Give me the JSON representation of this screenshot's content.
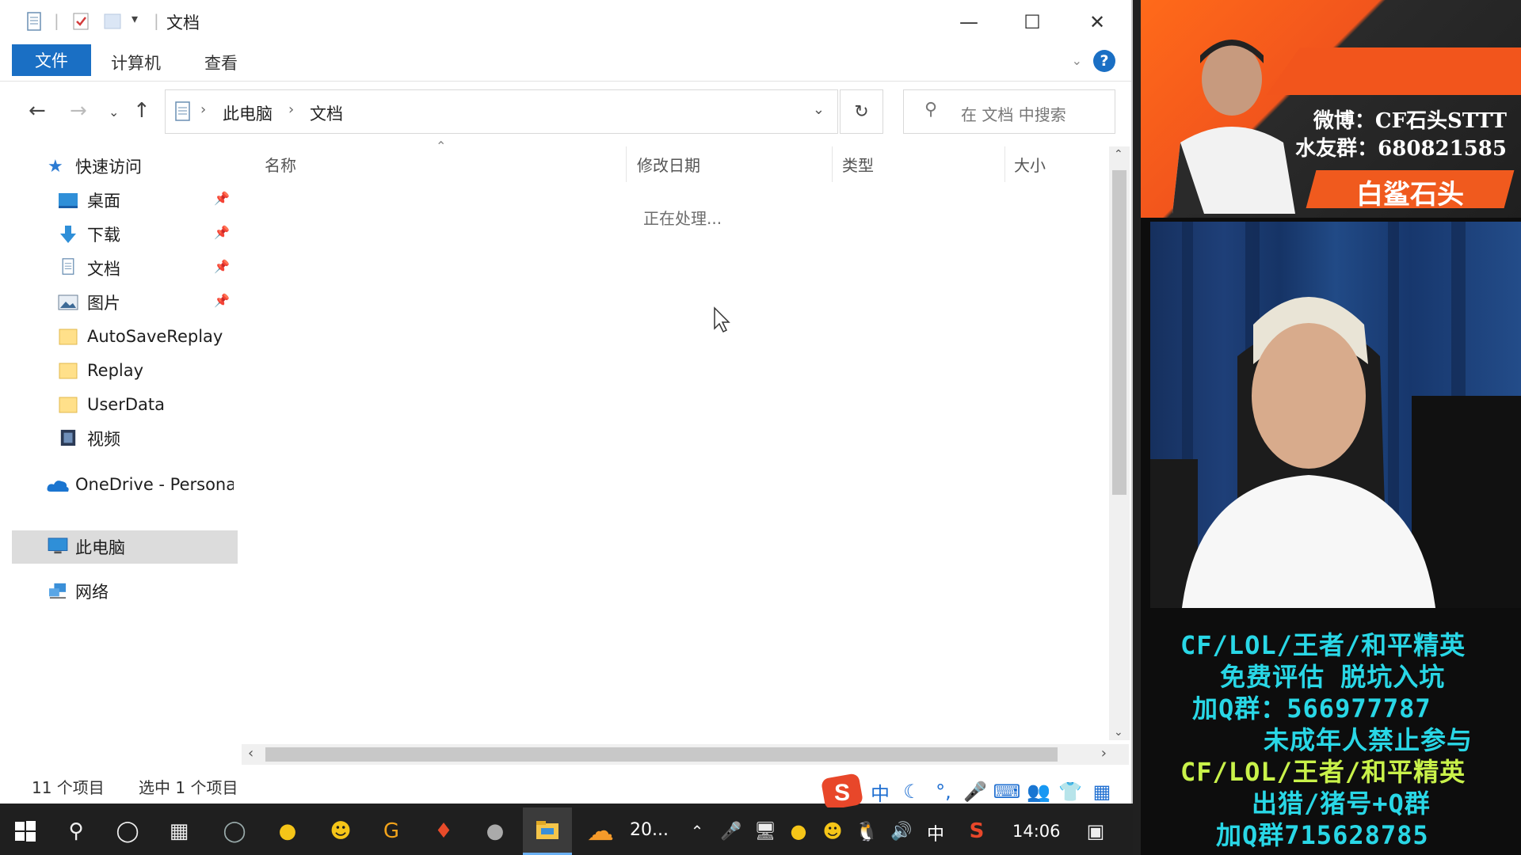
{
  "explorer": {
    "title": "文档",
    "ribbon": {
      "file_tab": "文件",
      "computer_tab": "计算机",
      "view_tab": "查看",
      "help": "?"
    },
    "breadcrumbs": [
      "此电脑",
      "文档"
    ],
    "search_placeholder": "在 文档 中搜索",
    "nav_pane": {
      "quick_access": "快速访问",
      "items": [
        "桌面",
        "下载",
        "文档",
        "图片",
        "AutoSaveReplay",
        "Replay",
        "UserData",
        "视频"
      ],
      "onedrive": "OneDrive - Personal",
      "this_pc": "此电脑",
      "network": "网络"
    },
    "columns": [
      "名称",
      "修改日期",
      "类型",
      "大小"
    ],
    "processing_text": "正在处理...",
    "status": {
      "count": "11 个项目",
      "selected": "选中 1 个项目"
    }
  },
  "ime": {
    "lang": "中"
  },
  "taskbar": {
    "weather": "20...",
    "input_lang": "中",
    "clock": "14:06"
  },
  "overlay": {
    "weibo": "微博：CF石头STTT",
    "fans": "水友群：680821585",
    "streamer_name": "白鲨石头",
    "promo": [
      "CF/LOL/王者/和平精英",
      "免费评估  脱坑入坑",
      "加Q群：566977787",
      "未成年人禁止参与",
      "CF/LOL/王者/和平精英",
      "出猎/猪号+Q群",
      "加Q群715628785"
    ]
  },
  "colors": {
    "accent": "#1a6fc4",
    "overlay_orange": "#f2551c",
    "promo_cyan": "#29d7e6",
    "promo_yellow": "#c9f24a"
  }
}
